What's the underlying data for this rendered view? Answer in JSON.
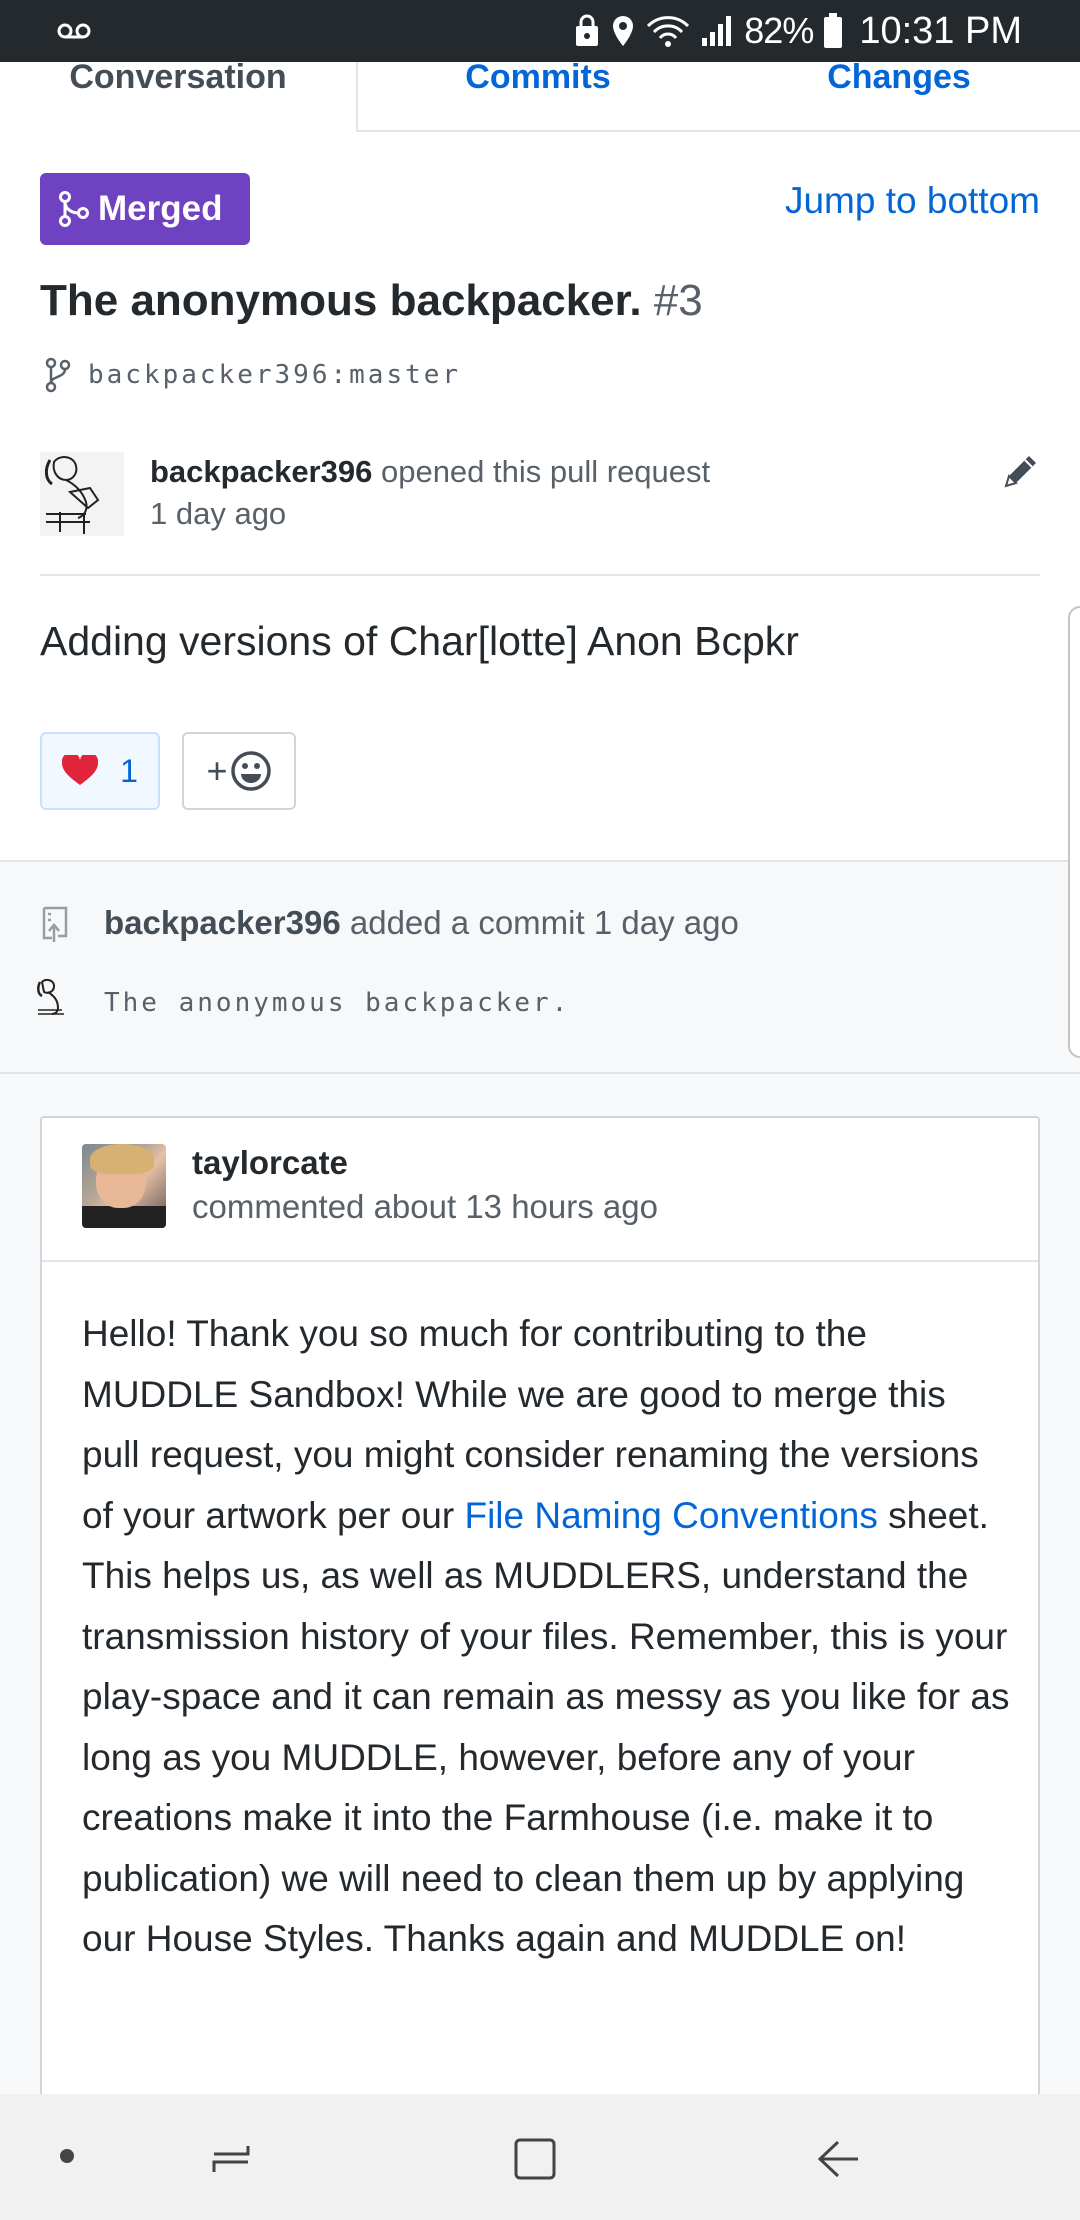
{
  "status_bar": {
    "battery_percent": "82%",
    "time": "10:31 PM",
    "icons": [
      "voicemail-icon",
      "lock-icon",
      "location-icon",
      "wifi-icon",
      "signal-icon",
      "battery-icon"
    ]
  },
  "tabs": [
    {
      "label": "Conversation",
      "active": true
    },
    {
      "label": "Commits",
      "active": false
    },
    {
      "label": "Changes",
      "active": false
    }
  ],
  "header": {
    "status_badge": "Merged",
    "jump_link": "Jump to bottom",
    "title": "The anonymous backpacker.",
    "number": "#3",
    "branch": "backpacker396:master"
  },
  "opener": {
    "username": "backpacker396",
    "action": "opened this pull request",
    "time": "1 day ago"
  },
  "pr_body": "Adding versions of Char[lotte] Anon Bcpkr",
  "reactions": {
    "heart_count": "1",
    "add_label": "+"
  },
  "commit_event": {
    "username": "backpacker396",
    "action": "added a commit",
    "time": "1 day ago",
    "message": "The anonymous backpacker."
  },
  "comment": {
    "author": "taylorcate",
    "meta": "commented about 13 hours ago",
    "body_before_link": "Hello! Thank you so much for contributing to the MUDDLE Sandbox! While we are good to merge this pull request, you might consider renaming the versions of your artwork per our ",
    "link_text": "File Naming Conventions",
    "body_after_link": " sheet. This helps us, as well as MUDDLERS, understand the transmission history of your files. Remember, this is your play-space and it can remain as messy as you like for as long as you MUDDLE, however, before any of your creations make it into the Farmhouse (i.e. make it to publication) we will need to clean them up by applying our House Styles. Thanks again and MUDDLE on!"
  },
  "colors": {
    "merged": "#6f42c1",
    "link": "#0366d6",
    "status_bar": "#24292e"
  }
}
